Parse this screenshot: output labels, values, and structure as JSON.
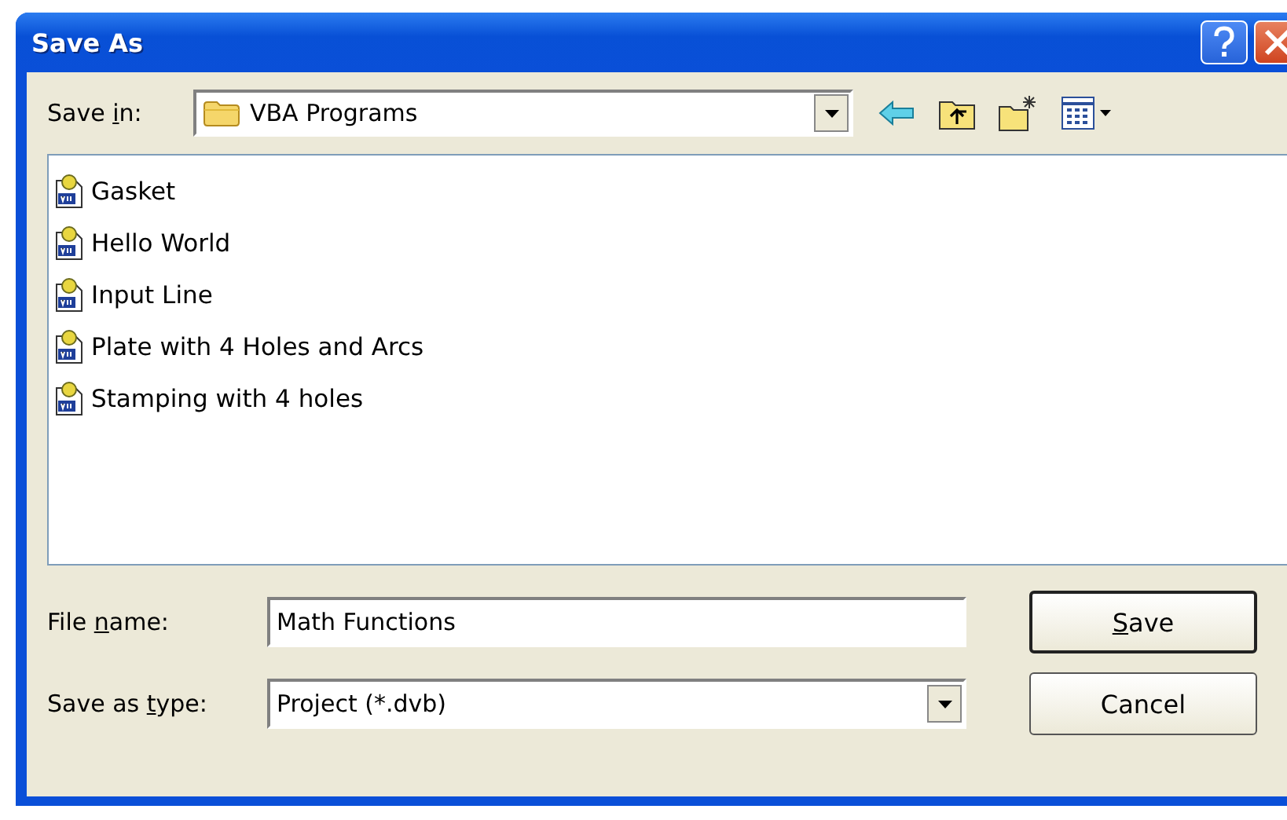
{
  "window": {
    "title": "Save As"
  },
  "save_in": {
    "label": {
      "before": "Save ",
      "key": "i",
      "after": "n:"
    },
    "value": "VBA Programs"
  },
  "files": [
    {
      "name": "Gasket",
      "selected": false
    },
    {
      "name": "Hello World",
      "selected": false
    },
    {
      "name": "Input Line",
      "selected": false
    },
    {
      "name": "Plate with 4 Holes and Arcs",
      "selected": false
    },
    {
      "name": "Stamping with 4 holes",
      "selected": false
    }
  ],
  "file_name": {
    "label": {
      "before": "File ",
      "key": "n",
      "after": "ame:"
    },
    "value": "Math Functions"
  },
  "save_as_type": {
    "label": {
      "before": "Save as ",
      "key": "t",
      "after": "ype:"
    },
    "value": "Project (*.dvb)"
  },
  "buttons": [
    {
      "kind": "default",
      "label": {
        "key": "S",
        "after": "ave"
      }
    },
    {
      "kind": "normal",
      "label": {
        "before": "Cancel"
      }
    }
  ]
}
